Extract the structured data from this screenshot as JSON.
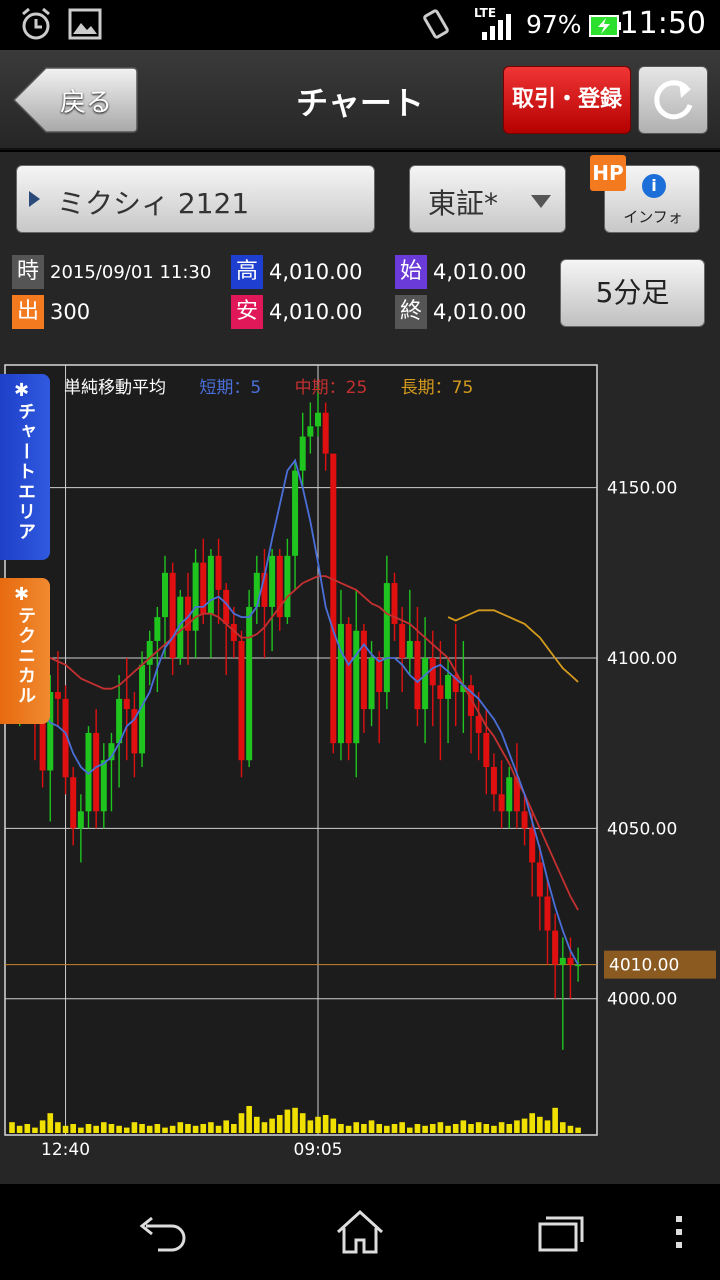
{
  "status_bar": {
    "time": "11:50",
    "battery": "97%",
    "network": "LTE"
  },
  "header": {
    "back_label": "戻る",
    "title": "チャート",
    "trade_label": "取引・登録",
    "refresh_icon": "refresh-icon"
  },
  "stock": {
    "name": "ミクシィ 2121",
    "market": "東証*",
    "hp_badge": "HP",
    "info_label": "インフォ",
    "interval_label": "5分足"
  },
  "quote": {
    "time_tag": "時",
    "time": "2015/09/01 11:30",
    "volume_tag": "出",
    "volume": "300",
    "high_tag": "高",
    "high": "4,010.00",
    "low_tag": "安",
    "low": "4,010.00",
    "open_tag": "始",
    "open": "4,010.00",
    "close_tag": "終",
    "close": "4,010.00"
  },
  "side_tabs": {
    "chart_area": "チャートエリア",
    "technical": "テクニカル"
  },
  "legend": {
    "title": "単純移動平均",
    "short": "短期：5",
    "mid": "中期：25",
    "long": "長期：75"
  },
  "colors": {
    "up": "#1fc41f",
    "down": "#e01010",
    "short_ma": "#4a6fd9",
    "mid_ma": "#c43030",
    "long_ma": "#d49a1e",
    "volume": "#f0e000",
    "current_price_tag": "#8a5a20"
  },
  "chart_data": {
    "type": "candlestick",
    "ylim": [
      3960,
      4186
    ],
    "y_ticks": [
      {
        "value": 4150,
        "label": "4150.00"
      },
      {
        "value": 4100,
        "label": "4100.00"
      },
      {
        "value": 4050,
        "label": "4050.00"
      },
      {
        "value": 4000,
        "label": "4000.00"
      }
    ],
    "current_price": {
      "value": 4010,
      "label": "4010.00"
    },
    "x_ticks": [
      {
        "index": 7,
        "label": "12:40"
      },
      {
        "index": 40,
        "label": "09:05"
      }
    ],
    "candles": [
      [
        4100,
        4115,
        4085,
        4090
      ],
      [
        4090,
        4120,
        4080,
        4105
      ],
      [
        4105,
        4112,
        4082,
        4088
      ],
      [
        4088,
        4098,
        4070,
        4083
      ],
      [
        4083,
        4090,
        4062,
        4067
      ],
      [
        4067,
        4095,
        4052,
        4090
      ],
      [
        4090,
        4102,
        4080,
        4088
      ],
      [
        4088,
        4092,
        4060,
        4065
      ],
      [
        4065,
        4068,
        4045,
        4050
      ],
      [
        4050,
        4060,
        4040,
        4055
      ],
      [
        4055,
        4080,
        4050,
        4078
      ],
      [
        4078,
        4085,
        4050,
        4055
      ],
      [
        4055,
        4075,
        4050,
        4070
      ],
      [
        4070,
        4078,
        4055,
        4075
      ],
      [
        4075,
        4095,
        4062,
        4088
      ],
      [
        4088,
        4100,
        4070,
        4085
      ],
      [
        4085,
        4090,
        4065,
        4072
      ],
      [
        4072,
        4102,
        4068,
        4098
      ],
      [
        4098,
        4108,
        4092,
        4105
      ],
      [
        4105,
        4115,
        4090,
        4112
      ],
      [
        4112,
        4130,
        4100,
        4125
      ],
      [
        4125,
        4128,
        4095,
        4100
      ],
      [
        4100,
        4120,
        4098,
        4118
      ],
      [
        4118,
        4125,
        4098,
        4108
      ],
      [
        4108,
        4132,
        4100,
        4128
      ],
      [
        4128,
        4135,
        4110,
        4113
      ],
      [
        4113,
        4132,
        4100,
        4130
      ],
      [
        4130,
        4135,
        4110,
        4120
      ],
      [
        4120,
        4122,
        4095,
        4110
      ],
      [
        4110,
        4115,
        4100,
        4105
      ],
      [
        4105,
        4108,
        4065,
        4070
      ],
      [
        4070,
        4120,
        4068,
        4115
      ],
      [
        4115,
        4130,
        4110,
        4125
      ],
      [
        4125,
        4132,
        4100,
        4115
      ],
      [
        4115,
        4132,
        4102,
        4130
      ],
      [
        4130,
        4132,
        4108,
        4112
      ],
      [
        4112,
        4135,
        4110,
        4130
      ],
      [
        4130,
        4158,
        4120,
        4155
      ],
      [
        4155,
        4172,
        4150,
        4165
      ],
      [
        4165,
        4175,
        4160,
        4168
      ],
      [
        4168,
        4180,
        4165,
        4172
      ],
      [
        4172,
        4175,
        4155,
        4160
      ],
      [
        4160,
        4125,
        4072,
        4075
      ],
      [
        4075,
        4120,
        4070,
        4110
      ],
      [
        4110,
        4112,
        4070,
        4075
      ],
      [
        4075,
        4120,
        4065,
        4108
      ],
      [
        4108,
        4110,
        4078,
        4085
      ],
      [
        4085,
        4105,
        4080,
        4100
      ],
      [
        4100,
        4102,
        4075,
        4090
      ],
      [
        4090,
        4130,
        4085,
        4122
      ],
      [
        4122,
        4125,
        4105,
        4110
      ],
      [
        4110,
        4115,
        4090,
        4100
      ],
      [
        4100,
        4120,
        4095,
        4105
      ],
      [
        4105,
        4115,
        4080,
        4085
      ],
      [
        4085,
        4112,
        4075,
        4100
      ],
      [
        4100,
        4108,
        4080,
        4092
      ],
      [
        4092,
        4105,
        4070,
        4088
      ],
      [
        4088,
        4100,
        4075,
        4095
      ],
      [
        4095,
        4110,
        4080,
        4090
      ],
      [
        4090,
        4105,
        4078,
        4092
      ],
      [
        4092,
        4095,
        4072,
        4083
      ],
      [
        4083,
        4090,
        4070,
        4078
      ],
      [
        4078,
        4085,
        4060,
        4068
      ],
      [
        4068,
        4072,
        4055,
        4060
      ],
      [
        4060,
        4070,
        4050,
        4055
      ],
      [
        4055,
        4068,
        4050,
        4065
      ],
      [
        4065,
        4075,
        4050,
        4055
      ],
      [
        4055,
        4060,
        4045,
        4050
      ],
      [
        4050,
        4055,
        4030,
        4040
      ],
      [
        4040,
        4045,
        4020,
        4030
      ],
      [
        4030,
        4035,
        4010,
        4020
      ],
      [
        4020,
        4025,
        4000,
        4010
      ],
      [
        4010,
        4018,
        3985,
        4012
      ],
      [
        4012,
        4018,
        4000,
        4010
      ],
      [
        4010,
        4015,
        4005,
        4010
      ]
    ],
    "ma_short": [
      4095,
      4096,
      4093,
      4088,
      4085,
      4081,
      4080,
      4078,
      4072,
      4068,
      4066,
      4068,
      4069,
      4071,
      4075,
      4080,
      4082,
      4086,
      4090,
      4097,
      4103,
      4106,
      4110,
      4112,
      4115,
      4115,
      4117,
      4118,
      4116,
      4113,
      4112,
      4112,
      4115,
      4124,
      4135,
      4145,
      4155,
      4158,
      4150,
      4140,
      4128,
      4115,
      4108,
      4102,
      4098,
      4101,
      4104,
      4101,
      4099,
      4100,
      4100,
      4098,
      4095,
      4093,
      4095,
      4097,
      4098,
      4096,
      4094,
      4092,
      4090,
      4088,
      4085,
      4082,
      4078,
      4072,
      4066,
      4060,
      4052,
      4044,
      4035,
      4027,
      4020,
      4014,
      4010
    ],
    "ma_mid": [
      4105,
      4104,
      4103,
      4102,
      4101,
      4100,
      4099,
      4098,
      4096,
      4094,
      4093,
      4092,
      4091,
      4091,
      4092,
      4094,
      4096,
      4098,
      4100,
      4102,
      4104,
      4106,
      4108,
      4110,
      4112,
      4113,
      4113,
      4112,
      4110,
      4108,
      4106,
      4106,
      4107,
      4109,
      4112,
      4115,
      4118,
      4120,
      4122,
      4123,
      4124,
      4124,
      4123,
      4122,
      4121,
      4120,
      4118,
      4116,
      4115,
      4113,
      4112,
      4111,
      4110,
      4108,
      4106,
      4104,
      4102,
      4100,
      4096,
      4092,
      4088,
      4084,
      4080,
      4077,
      4073,
      4069,
      4064,
      4060,
      4055,
      4050,
      4045,
      4040,
      4035,
      4030,
      4026
    ],
    "ma_long": [
      null,
      null,
      null,
      null,
      null,
      null,
      null,
      null,
      null,
      null,
      null,
      null,
      null,
      null,
      null,
      null,
      null,
      null,
      null,
      null,
      null,
      null,
      null,
      null,
      null,
      null,
      null,
      null,
      null,
      null,
      null,
      null,
      null,
      null,
      null,
      null,
      null,
      null,
      null,
      null,
      null,
      null,
      null,
      null,
      null,
      null,
      null,
      null,
      null,
      null,
      null,
      null,
      null,
      null,
      null,
      null,
      null,
      4112,
      4111,
      4112,
      4113,
      4114,
      4114,
      4114,
      4113,
      4112,
      4111,
      4110,
      4108,
      4106,
      4103,
      4100,
      4097,
      4095,
      4093
    ],
    "volume": [
      12,
      8,
      10,
      6,
      14,
      22,
      12,
      8,
      10,
      6,
      10,
      8,
      12,
      10,
      8,
      6,
      12,
      10,
      8,
      10,
      6,
      8,
      12,
      10,
      8,
      10,
      12,
      8,
      14,
      10,
      22,
      30,
      18,
      12,
      16,
      20,
      26,
      28,
      22,
      14,
      18,
      20,
      16,
      10,
      8,
      12,
      10,
      14,
      10,
      8,
      10,
      12,
      6,
      10,
      8,
      10,
      12,
      8,
      10,
      14,
      10,
      12,
      10,
      8,
      12,
      10,
      14,
      16,
      22,
      18,
      14,
      28,
      12,
      8,
      6
    ]
  },
  "nav": {
    "back": "back-icon",
    "home": "home-icon",
    "recents": "recents-icon",
    "menu": "menu-icon"
  }
}
